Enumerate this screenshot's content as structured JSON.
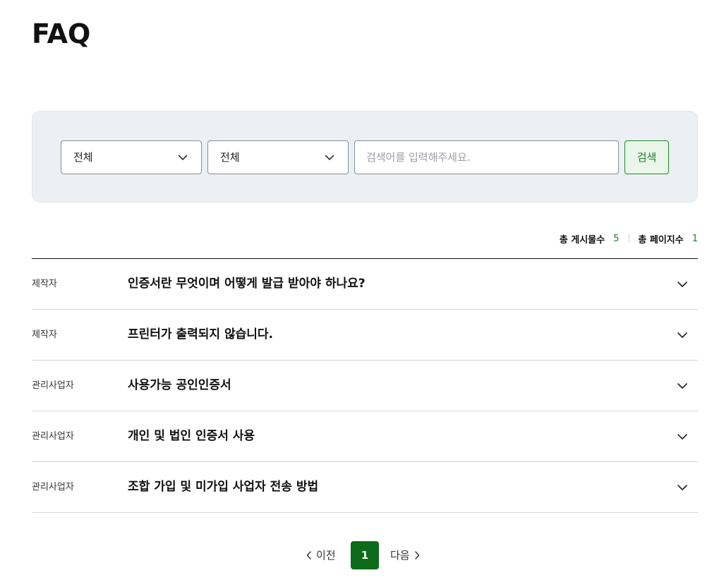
{
  "page": {
    "title": "FAQ"
  },
  "search": {
    "select1_value": "전체",
    "select2_value": "전체",
    "input_placeholder": "검색어를 입력해주세요.",
    "input_value": "",
    "button_label": "검색"
  },
  "stats": {
    "total_posts_label": "총 게시물수",
    "total_posts": "5",
    "total_pages_label": "총 페이지수",
    "total_pages": "1"
  },
  "faq": [
    {
      "category": "제작자",
      "question": "인증서란 무엇이며 어떻게 발급 받아야 하나요?"
    },
    {
      "category": "제작자",
      "question": "프린터가 출력되지 않습니다."
    },
    {
      "category": "관리사업자",
      "question": "사용가능 공인인증서"
    },
    {
      "category": "관리사업자",
      "question": "개인 및 법인 인증서 사용"
    },
    {
      "category": "관리사업자",
      "question": "조합 가입 및 미가입 사업자 전송 방법"
    }
  ],
  "pagination": {
    "prev_label": "이전",
    "current_page": "1",
    "next_label": "다음"
  },
  "colors": {
    "accent": "#0c6b19",
    "accent_text": "#1e7a28",
    "panel_bg": "#eceff3"
  }
}
